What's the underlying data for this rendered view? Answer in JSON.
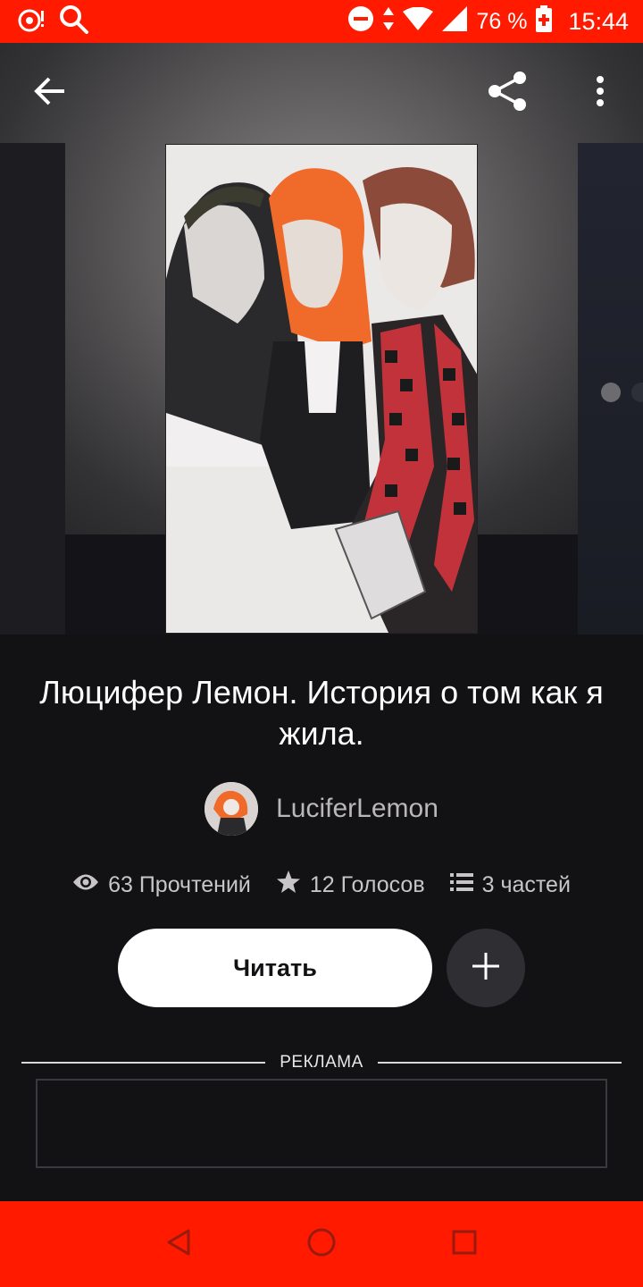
{
  "status_bar": {
    "battery_percent": "76 %",
    "time": "15:44",
    "icons": [
      "notification-icon",
      "search-icon",
      "dnd-icon",
      "data-arrows-icon",
      "wifi-icon",
      "signal-icon",
      "battery-icon"
    ]
  },
  "toolbar": {
    "back_icon": "back-arrow-icon",
    "share_icon": "share-icon",
    "more_icon": "more-vert-icon"
  },
  "story": {
    "title": "Люцифер Лемон. История о том как я жила.",
    "author": "LuciferLemon",
    "stats": {
      "reads": "63 Прочтений",
      "votes": "12 Голосов",
      "parts": "3 частей"
    },
    "read_label": "Читать"
  },
  "ad": {
    "label": "РЕКЛАМА"
  },
  "colors": {
    "accent": "#ff1a00",
    "background": "#121114",
    "button": "#ffffff",
    "add_button": "#2f2e32"
  }
}
